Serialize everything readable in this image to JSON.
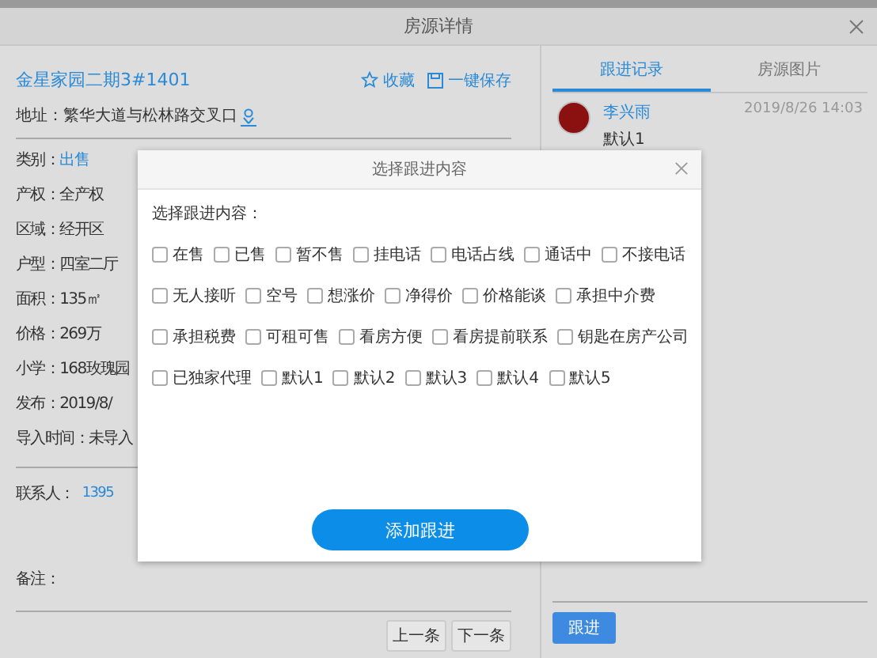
{
  "window": {
    "title": "房源详情"
  },
  "listing": {
    "title": "金星家园二期3#1401",
    "actions": [
      {
        "kind": "star",
        "label": "收藏"
      },
      {
        "kind": "save",
        "label": "一键保存"
      }
    ],
    "address": "地址：繁华大道与松林路交叉口",
    "fields": [
      {
        "label": "类别：",
        "value": "出售",
        "link": true
      },
      {
        "label": "产权：",
        "value": "全产权",
        "link": false
      },
      {
        "label": "区域：",
        "value": "经开区",
        "link": false
      },
      {
        "label": "户型：",
        "value": "四室二厅",
        "link": false
      },
      {
        "label": "面积：",
        "value": "135㎡",
        "link": false
      },
      {
        "label": "价格：",
        "value": "269万",
        "link": false
      },
      {
        "label": "小学：",
        "value": "168玫瑰园",
        "link": false
      },
      {
        "label": "发布：",
        "value": "2019/8/",
        "link": false
      },
      {
        "label": "导入时间：",
        "value": "未导入",
        "link": false
      }
    ],
    "contact": {
      "label": "联系人：",
      "value": "1395"
    },
    "note": {
      "label": "备注："
    },
    "nav_buttons": [
      "上一条",
      "下一条"
    ]
  },
  "side": {
    "tabs": [
      {
        "label": "跟进记录",
        "selected": true
      },
      {
        "label": "房源图片",
        "selected": false
      }
    ],
    "records": [
      {
        "name": "李兴雨",
        "time": "2019/8/26 14:03",
        "content": "默认1"
      }
    ],
    "button": "跟进"
  },
  "modal": {
    "title": "选择跟进内容",
    "prompt": "选择跟进内容：",
    "option_rows": [
      [
        {
          "label": "在售",
          "checked": false
        },
        {
          "label": "已售",
          "checked": false
        },
        {
          "label": "暂不售",
          "checked": false
        },
        {
          "label": "挂电话",
          "checked": false
        },
        {
          "label": "电话占线",
          "checked": false
        },
        {
          "label": "通话中",
          "checked": false
        },
        {
          "label": "不接电话",
          "checked": false
        }
      ],
      [
        {
          "label": "无人接听",
          "checked": false
        },
        {
          "label": "空号",
          "checked": false
        },
        {
          "label": "想涨价",
          "checked": false
        },
        {
          "label": "净得价",
          "checked": false
        },
        {
          "label": "价格能谈",
          "checked": false
        },
        {
          "label": "承担中介费",
          "checked": false
        }
      ],
      [
        {
          "label": "承担税费",
          "checked": false
        },
        {
          "label": "可租可售",
          "checked": false
        },
        {
          "label": "看房方便",
          "checked": false
        },
        {
          "label": "看房提前联系",
          "checked": false
        },
        {
          "label": "钥匙在房产公司",
          "checked": false
        }
      ],
      [
        {
          "label": "已独家代理",
          "checked": false
        },
        {
          "label": "默认1",
          "checked": false
        },
        {
          "label": "默认2",
          "checked": false
        },
        {
          "label": "默认3",
          "checked": false
        },
        {
          "label": "默认4",
          "checked": false
        },
        {
          "label": "默认5",
          "checked": false
        }
      ]
    ],
    "submit": "添加跟进"
  }
}
